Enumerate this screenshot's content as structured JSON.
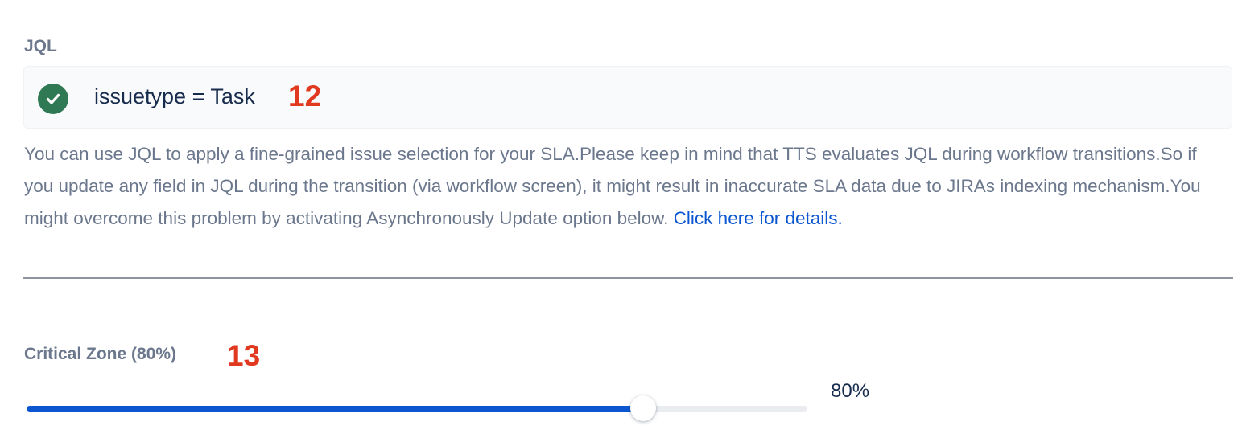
{
  "jql": {
    "label": "JQL",
    "value": "issuetype = Task",
    "status_icon": "check-circle-icon",
    "status_color": "#2f7a54",
    "annotation": "12"
  },
  "help": {
    "text": "You can use JQL to apply a fine-grained issue selection for your SLA.Please keep in mind that TTS evaluates JQL during workflow transitions.So if you update any field in JQL during the transition (via workflow screen), it might result in inaccurate SLA data due to JIRAs indexing mechanism.You might overcome this problem by activating Asynchronously Update option below. ",
    "link_text": "Click here for details."
  },
  "critical_zone": {
    "label": "Critical Zone (80%)",
    "annotation": "13",
    "value_text": "80%",
    "percent": 79,
    "fill_color": "#0c57d0"
  }
}
